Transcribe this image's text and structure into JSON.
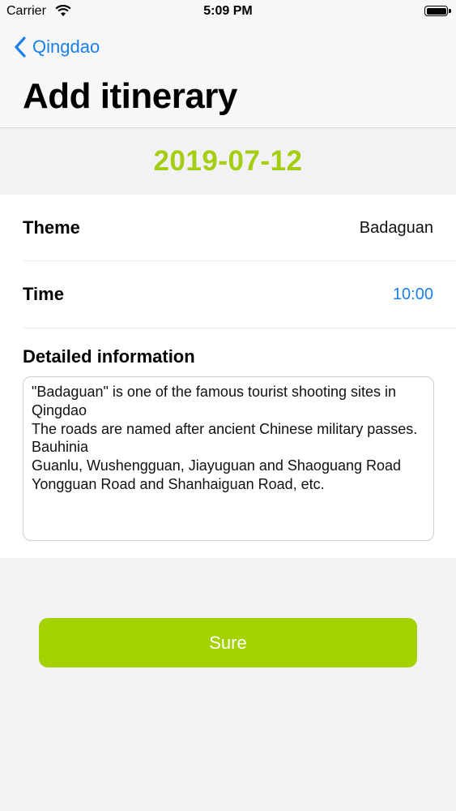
{
  "status_bar": {
    "carrier": "Carrier",
    "time": "5:09 PM",
    "wifi_icon": "wifi-icon",
    "battery_icon": "battery-icon"
  },
  "nav": {
    "back_label": "Qingdao",
    "back_icon": "chevron-left-icon",
    "title": "Add itinerary"
  },
  "date": "2019-07-12",
  "form": {
    "theme_label": "Theme",
    "theme_value": "Badaguan",
    "time_label": "Time",
    "time_value": "10:00",
    "detail_label": "Detailed information",
    "detail_text": "\"Badaguan\" is one of the famous tourist shooting sites in Qingdao\nThe roads are named after ancient Chinese military passes. Bauhinia\nGuanlu, Wushengguan, Jiayuguan and Shaoguang Road\nYongguan Road and Shanhaiguan Road, etc."
  },
  "submit_label": "Sure",
  "colors": {
    "accent_green": "#a4d200",
    "date_green": "#a4ce0f",
    "link_blue": "#1a7fe8"
  }
}
